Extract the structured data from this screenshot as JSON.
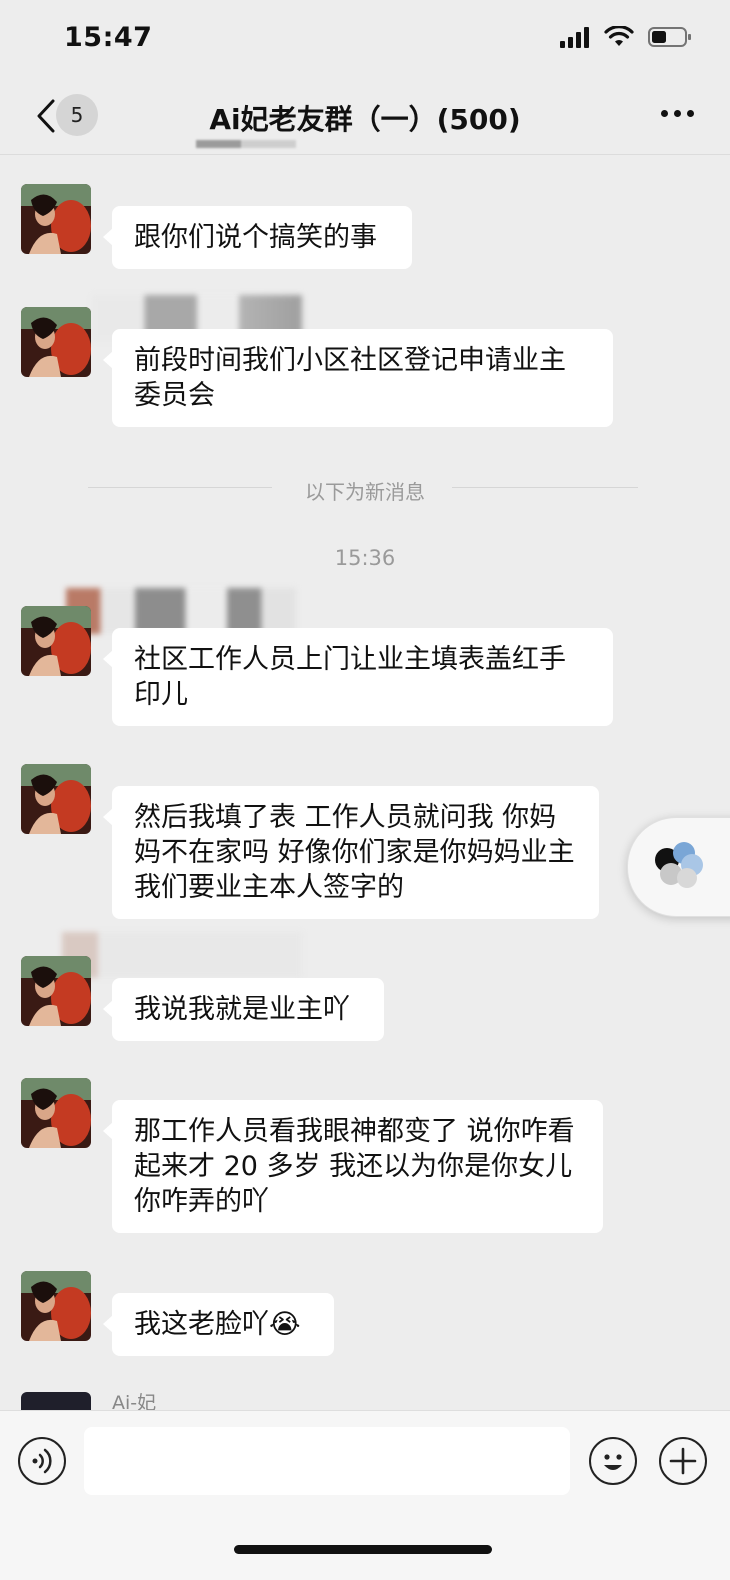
{
  "status_bar": {
    "time": "15:47"
  },
  "header": {
    "unread_count": "5",
    "title": "Ai妃老友群（一）(500)"
  },
  "divider": {
    "label": "以下为新消息"
  },
  "timestamp": "15:36",
  "messages": [
    {
      "text": "跟你们说个搞笑的事"
    },
    {
      "text": "前段时间我们小区社区登记申请业主委员会"
    },
    {
      "text": "社区工作人员上门让业主填表盖红手印儿"
    },
    {
      "text": "然后我填了表 工作人员就问我 你妈妈不在家吗 好像你们家是你妈妈业主 我们要业主本人签字的"
    },
    {
      "text": "我说我就是业主吖"
    },
    {
      "text": "那工作人员看我眼神都变了 说你咋看起来才 20 多岁 我还以为你是你女儿 你咋弄的吖"
    },
    {
      "text": "我这老脸吖",
      "emoji": "😭"
    }
  ],
  "last_sender": {
    "name": "Ai-妃"
  },
  "colors": {
    "background": "#ededed",
    "bubble": "#ffffff",
    "system_text": "#9a9a9a"
  }
}
